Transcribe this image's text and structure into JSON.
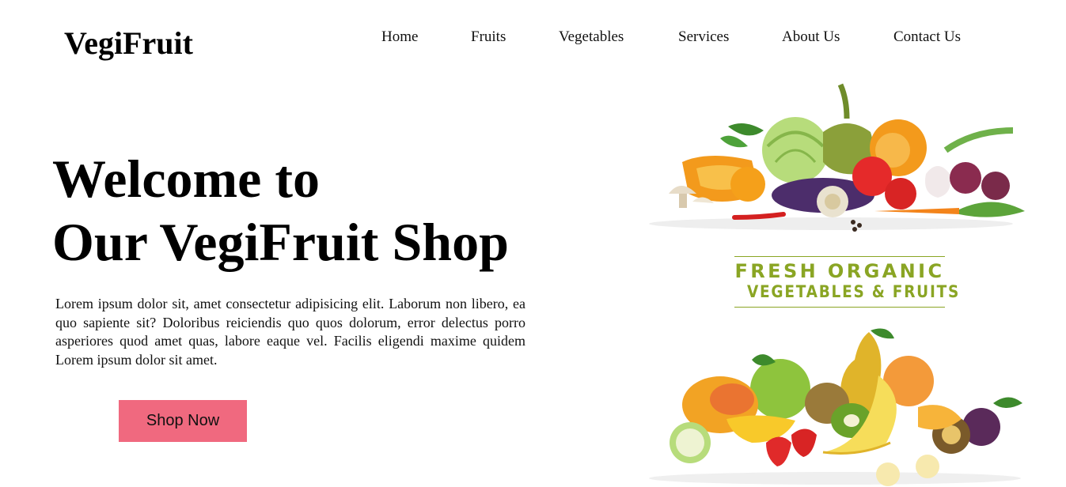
{
  "brand": {
    "name": "VegiFruit"
  },
  "nav": {
    "items": [
      {
        "label": "Home"
      },
      {
        "label": "Fruits"
      },
      {
        "label": "Vegetables"
      },
      {
        "label": "Services"
      },
      {
        "label": "About Us"
      },
      {
        "label": "Contact Us"
      }
    ]
  },
  "hero": {
    "title_line1": "Welcome to",
    "title_line2": "Our VegiFruit Shop",
    "description": "Lorem ipsum dolor sit, amet consectetur adipisicing elit. Laborum non libero, ea quo sapiente sit? Doloribus reiciendis quo quos dolorum, error delectus porro asperiores quod amet quas, labore eaque vel. Facilis eligendi maxime quidem Lorem ipsum dolor sit amet.",
    "cta_label": "Shop Now"
  },
  "banner": {
    "line1": "FRESH ORGANIC",
    "line2": "VEGETABLES & FRUITS"
  },
  "colors": {
    "cta_background": "#f0697f",
    "banner_green": "#8aa524",
    "text": "#111111"
  },
  "icons": {
    "vegetables_illustration": "vegetables-pile-icon",
    "fruits_illustration": "fruits-pile-icon"
  }
}
